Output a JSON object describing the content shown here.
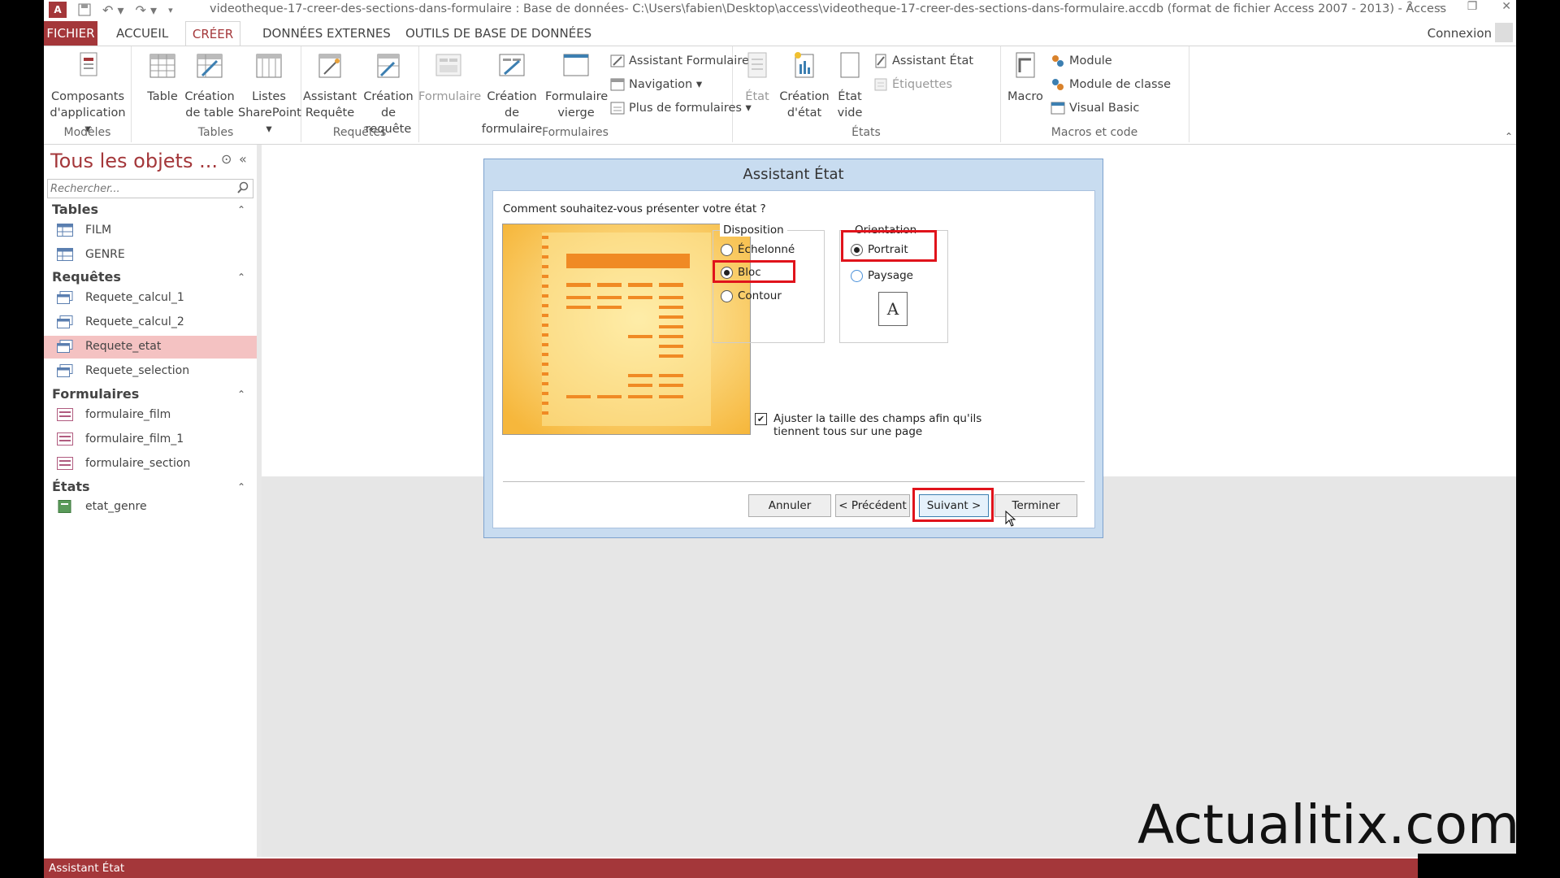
{
  "window": {
    "title": "videotheque-17-creer-des-sections-dans-formulaire : Base de données- C:\\Users\\fabien\\Desktop\\access\\videotheque-17-creer-des-sections-dans-formulaire.accdb (format de fichier Access 2007 - 2013) - Access",
    "app_icon": "A",
    "help": "?",
    "connexion": "Connexion"
  },
  "tabs": [
    "FICHIER",
    "ACCUEIL",
    "CRÉER",
    "DONNÉES EXTERNES",
    "OUTILS DE BASE DE DONNÉES"
  ],
  "ribbon": {
    "modeles": {
      "label": "Modèles",
      "composants": "Composants d'application ▾",
      "composants_l1": "Composants",
      "composants_l2": "d'application ▾"
    },
    "tables": {
      "label": "Tables",
      "table": "Table",
      "creation_l1": "Création",
      "creation_l2": "de table",
      "listes_l1": "Listes",
      "listes_l2": "SharePoint ▾"
    },
    "requetes": {
      "label": "Requêtes",
      "assistant_l1": "Assistant",
      "assistant_l2": "Requête",
      "creation_l1": "Création",
      "creation_l2": "de requête"
    },
    "formulaires": {
      "label": "Formulaires",
      "formulaire": "Formulaire",
      "creation_l1": "Création de",
      "creation_l2": "formulaire",
      "vierge_l1": "Formulaire",
      "vierge_l2": "vierge",
      "assistant": "Assistant Formulaire",
      "navigation": "Navigation ▾",
      "plus": "Plus de formulaires ▾"
    },
    "etats": {
      "label": "États",
      "etat": "État",
      "creation_l1": "Création",
      "creation_l2": "d'état",
      "vide_l1": "État",
      "vide_l2": "vide",
      "assistant": "Assistant État",
      "etiquettes": "Étiquettes"
    },
    "macros": {
      "label": "Macros et code",
      "macro": "Macro",
      "module": "Module",
      "module_classe": "Module de classe",
      "vb": "Visual Basic"
    }
  },
  "nav": {
    "title": "Tous les objets ...",
    "search_placeholder": "Rechercher...",
    "sections": [
      {
        "name": "Tables",
        "items": [
          "FILM",
          "GENRE"
        ]
      },
      {
        "name": "Requêtes",
        "items": [
          "Requete_calcul_1",
          "Requete_calcul_2",
          "Requete_etat",
          "Requete_selection"
        ]
      },
      {
        "name": "Formulaires",
        "items": [
          "formulaire_film",
          "formulaire_film_1",
          "formulaire_section"
        ]
      },
      {
        "name": "États",
        "items": [
          "etat_genre"
        ]
      }
    ],
    "selected": "Requete_etat"
  },
  "dialog": {
    "title": "Assistant État",
    "question": "Comment souhaitez-vous présenter votre état ?",
    "disposition": {
      "label": "Disposition",
      "options": [
        "Échelonné",
        "Bloc",
        "Contour"
      ],
      "selected": "Bloc"
    },
    "orientation": {
      "label": "Orientation",
      "options": [
        "Portrait",
        "Paysage"
      ],
      "selected": "Portrait",
      "icon_letter": "A"
    },
    "checkbox": {
      "line1": "Ajuster la taille des champs afin qu'ils",
      "line2": "tiennent tous sur une page",
      "checked": true
    },
    "buttons": {
      "annuler": "Annuler",
      "precedent": "< Précédent",
      "suivant": "Suivant >",
      "terminer": "Terminer"
    }
  },
  "status": "Assistant État",
  "watermark": "Actualitix.com",
  "colors": {
    "accent": "#a4373a",
    "highlight": "#e0131b",
    "selected_row": "#f4c2c2",
    "preview": "#f7c34e"
  }
}
